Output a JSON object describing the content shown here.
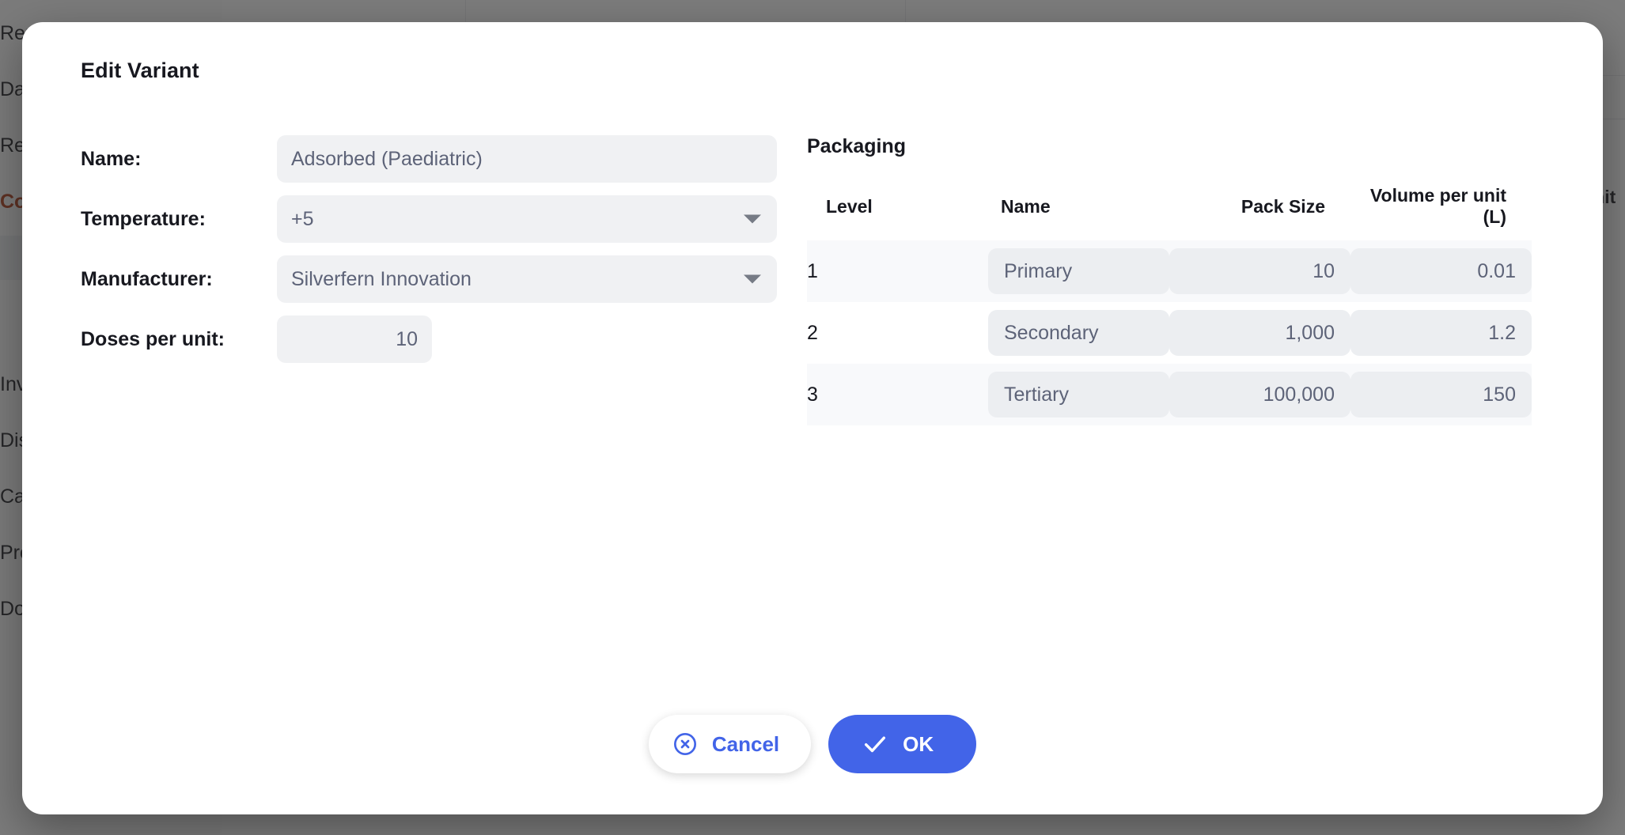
{
  "background": {
    "sidebar_items": [
      {
        "label": "Reports",
        "accent": false
      },
      {
        "label": "Da",
        "accent": false
      },
      {
        "label": "Rec",
        "accent": false
      },
      {
        "label": "Col",
        "accent": true
      },
      {
        "label": "Inv",
        "accent": false
      },
      {
        "label": "Dis",
        "accent": false
      },
      {
        "label": "Cal",
        "accent": false
      },
      {
        "label": "Pro",
        "accent": false
      },
      {
        "label": "Docs",
        "accent": false
      }
    ],
    "column_header": "er unit",
    "trash_icon": "trash-icon"
  },
  "modal": {
    "title": "Edit Variant",
    "form": {
      "fields": [
        {
          "label": "Name:",
          "value": "Adsorbed (Paediatric)",
          "type": "text",
          "width": "wide",
          "align": "left"
        },
        {
          "label": "Temperature:",
          "value": "+5",
          "type": "select",
          "width": "wide",
          "align": "left"
        },
        {
          "label": "Manufacturer:",
          "value": "Silverfern Innovation",
          "type": "select",
          "width": "wide",
          "align": "left"
        },
        {
          "label": "Doses per unit:",
          "value": "10",
          "type": "number",
          "width": "narrow",
          "align": "right"
        }
      ]
    },
    "packaging": {
      "title": "Packaging",
      "columns": [
        "Level",
        "Name",
        "Pack Size",
        "Volume per unit (L)"
      ],
      "rows": [
        {
          "level": "1",
          "name": "Primary",
          "pack_size": "10",
          "volume": "0.01"
        },
        {
          "level": "2",
          "name": "Secondary",
          "pack_size": "1,000",
          "volume": "1.2"
        },
        {
          "level": "3",
          "name": "Tertiary",
          "pack_size": "100,000",
          "volume": "150"
        }
      ]
    },
    "footer": {
      "cancel_label": "Cancel",
      "cancel_icon": "circle-x-icon",
      "ok_label": "OK",
      "ok_icon": "check-icon"
    }
  },
  "colors": {
    "accent": "#4264e8",
    "field_background": "#f0f1f3",
    "row_stripe": "#f8f9fb",
    "text_primary": "#17181f",
    "text_value": "#5d6378",
    "background_accent": "#b03a16"
  }
}
